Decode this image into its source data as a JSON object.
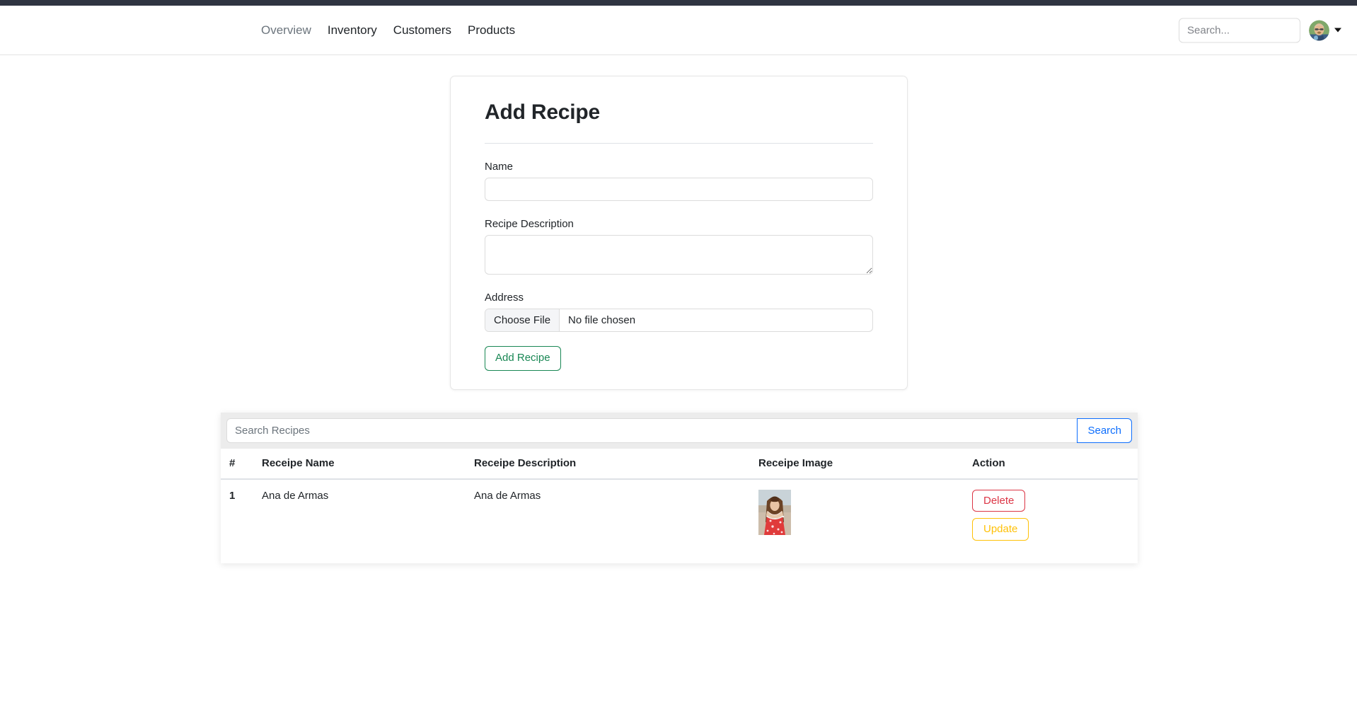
{
  "navbar": {
    "links": [
      {
        "label": "Overview",
        "state": "muted"
      },
      {
        "label": "Inventory",
        "state": "normal"
      },
      {
        "label": "Customers",
        "state": "normal"
      },
      {
        "label": "Products",
        "state": "normal"
      }
    ],
    "search_placeholder": "Search...",
    "search_value": "",
    "avatar_icon": "user-avatar-photo",
    "caret_icon": "caret-down-icon"
  },
  "form_card": {
    "title": "Add Recipe",
    "fields": [
      {
        "label": "Name",
        "type": "text",
        "value": "",
        "placeholder": ""
      },
      {
        "label": "Recipe Description",
        "type": "textarea",
        "value": "",
        "placeholder": ""
      },
      {
        "label": "Address",
        "type": "file"
      }
    ],
    "file_button_label": "Choose File",
    "file_status": "No file chosen",
    "submit_label": "Add Recipe"
  },
  "recipes_panel": {
    "search_placeholder": "Search Recipes",
    "search_value": "",
    "search_button_label": "Search",
    "columns": [
      "#",
      "Receipe Name",
      "Receipe Description",
      "Receipe Image",
      "Action"
    ],
    "rows": [
      {
        "num": "1",
        "name": "Ana de Armas",
        "description": "Ana de Armas",
        "image_icon": "recipe-thumbnail-photo",
        "delete_label": "Delete",
        "update_label": "Update"
      }
    ]
  },
  "colors": {
    "top_strip": "#2f3441",
    "success": "#198754",
    "primary": "#0d6efd",
    "danger": "#dc3545",
    "warning": "#ffc107",
    "muted_text": "#6c757d"
  }
}
